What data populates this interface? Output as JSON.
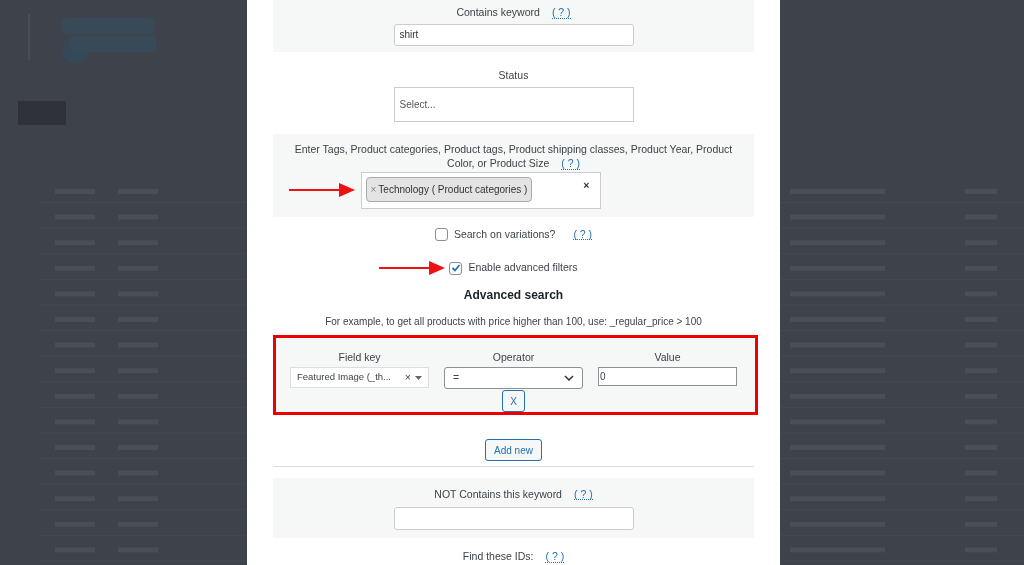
{
  "search_form": {
    "keyword": {
      "label": "Contains keyword",
      "help": "( ? )",
      "value": "shirt"
    },
    "status": {
      "label": "Status",
      "placeholder": "Select..."
    },
    "taxonomies": {
      "label": "Enter Tags, Product categories, Product tags, Product shipping classes, Product Year, Product Color, or Product Size",
      "help": "( ? )",
      "tags": [
        {
          "remove": "×",
          "text": "Technology ( Product categories )"
        }
      ],
      "clear": "×",
      "annotated": true
    },
    "search_variations": {
      "label": "Search on variations?",
      "help": "( ? )",
      "checked": false
    },
    "advanced_filters": {
      "label": "Enable advanced filters",
      "checked": true,
      "annotated": true
    },
    "advanced_search": {
      "title": "Advanced search",
      "example": "For example, to get all products with price higher than 100, use: _regular_price > 100",
      "highlighted": true,
      "rows": [
        {
          "field_key_label": "Field key",
          "field_key": "Featured Image (_th...",
          "field_clear": "×",
          "operator_label": "Operator",
          "operator": "=",
          "value_label": "Value",
          "value": "0",
          "remove": "X"
        }
      ],
      "add_button": "Add new"
    },
    "not_keyword": {
      "label": "NOT Contains this keyword",
      "help": "( ? )"
    },
    "ids": {
      "label": "Find these IDs:",
      "help": "( ? )"
    }
  }
}
